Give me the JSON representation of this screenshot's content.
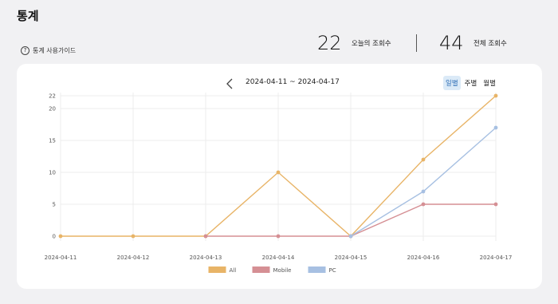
{
  "header": {
    "title": "통계",
    "guide_icon": "question-circle-icon",
    "guide_label": "통계 사용가이드"
  },
  "stats": {
    "today_value": "22",
    "today_label": "오늘의 조회수",
    "total_value": "44",
    "total_label": "전체 조회수"
  },
  "toolbar": {
    "prev_icon": "chevron-left-icon",
    "date_range": "2024-04-11 ~ 2024-04-17",
    "tabs": [
      {
        "label": "일별",
        "active": true
      },
      {
        "label": "주별",
        "active": false
      },
      {
        "label": "월별",
        "active": false
      }
    ]
  },
  "chart_data": {
    "type": "line",
    "x": [
      "2024-04-11",
      "2024-04-12",
      "2024-04-13",
      "2024-04-14",
      "2024-04-15",
      "2024-04-16",
      "2024-04-17"
    ],
    "yticks": [
      0,
      5,
      10,
      15,
      20,
      22
    ],
    "ylim": [
      0,
      22
    ],
    "grid": true,
    "legend_position": "bottom",
    "series": [
      {
        "name": "All",
        "color": "#e8b467",
        "values": [
          0,
          0,
          0,
          10,
          0,
          12,
          22
        ]
      },
      {
        "name": "Mobile",
        "color": "#d58f94",
        "values": [
          null,
          null,
          0,
          0,
          0,
          5,
          5
        ]
      },
      {
        "name": "PC",
        "color": "#a7c0e2",
        "values": [
          null,
          null,
          null,
          null,
          0,
          7,
          17
        ]
      }
    ]
  }
}
